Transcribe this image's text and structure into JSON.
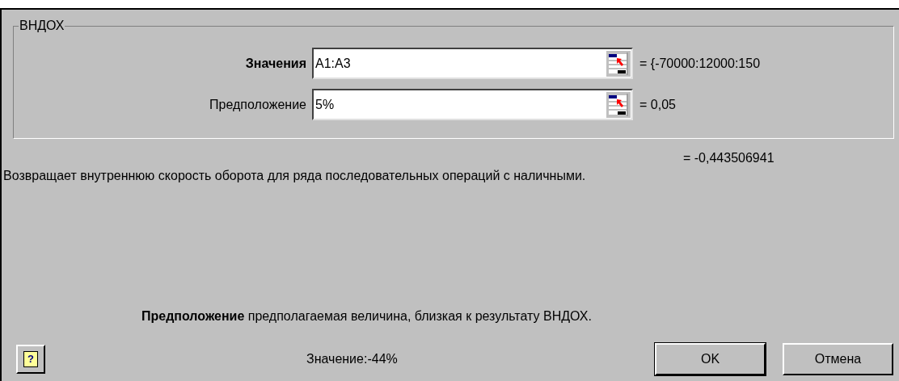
{
  "group": {
    "title": "ВНДОХ",
    "arguments": [
      {
        "label": "Значения",
        "required": true,
        "value": "A1:A3",
        "result": "= {-70000:12000:150"
      },
      {
        "label": "Предположение",
        "required": false,
        "value": "5%",
        "result": "= 0,05"
      }
    ]
  },
  "formula_result": "= -0,443506941",
  "description": "Возвращает внутреннюю скорость оборота для ряда последовательных операций с наличными.",
  "argument_help": "**Предположение** предполагаемая величина, близкая к результату ВНДОХ.",
  "help_button": "?",
  "value_text": "Значение:-44%",
  "buttons": [
    "OK",
    "Отмена"
  ]
}
